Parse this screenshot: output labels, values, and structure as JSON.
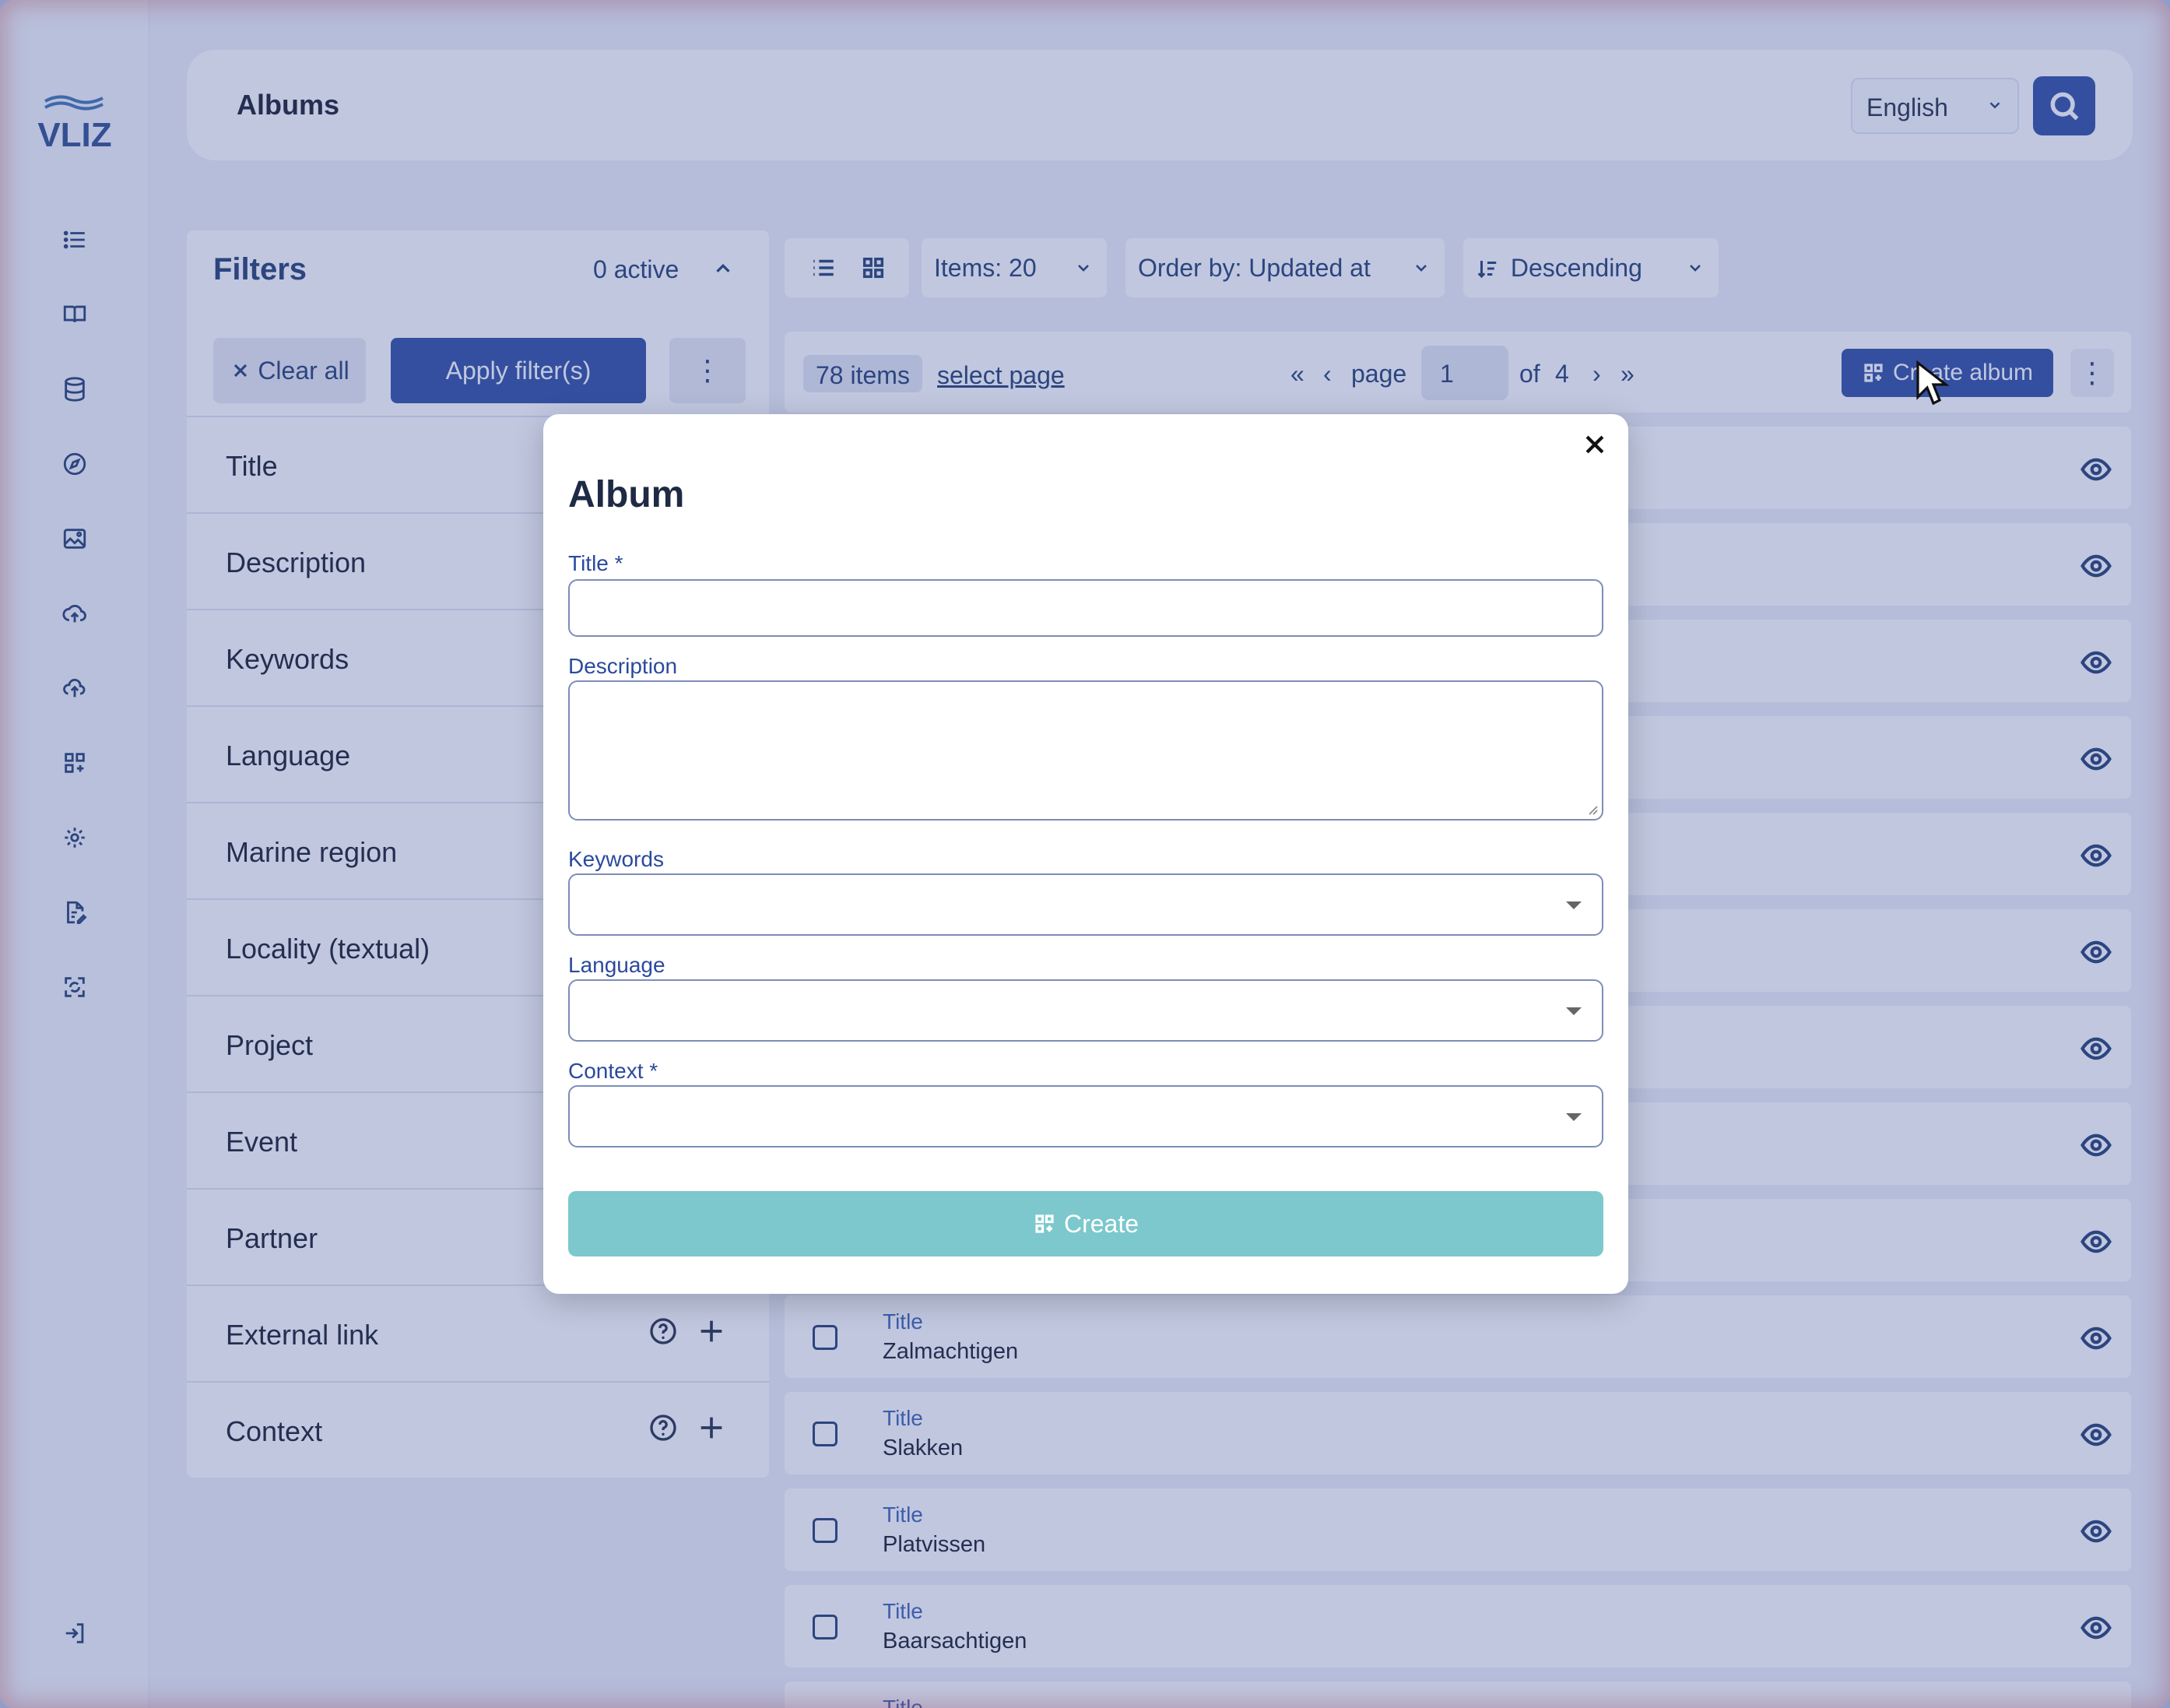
{
  "app": {
    "logo_text": "VLIZ"
  },
  "header": {
    "title": "Albums",
    "language": "English"
  },
  "sidebar": {
    "icons": [
      "list-icon",
      "book-icon",
      "database-icon",
      "compass-icon",
      "image-icon",
      "cloud-upload-icon",
      "upload-icon",
      "grid-plus-icon",
      "settings-icon",
      "document-edit-icon",
      "expand-icon",
      "logout-icon"
    ]
  },
  "filters": {
    "title": "Filters",
    "active": "0 active",
    "clear_all": "Clear all",
    "apply": "Apply filter(s)",
    "rows": [
      "Title",
      "Description",
      "Keywords",
      "Language",
      "Marine region",
      "Locality (textual)",
      "Project",
      "Event",
      "Partner",
      "External link",
      "Context"
    ]
  },
  "toolbar": {
    "items": "Items: 20",
    "order_by": "Order by: Updated at",
    "direction": "Descending"
  },
  "pagination": {
    "count": "78 items",
    "select_page": "select page",
    "first": "«",
    "prev": "‹",
    "page_label": "page",
    "page_value": "1",
    "of_label": "of",
    "total_pages": "4",
    "next": "›",
    "last": "»",
    "create_album": "Create album"
  },
  "list": {
    "field_label": "Title",
    "items": [
      "Zalmachtigen",
      "Slakken",
      "Platvissen",
      "Baarsachtigen"
    ]
  },
  "modal": {
    "title": "Album",
    "title_label": "Title *",
    "description_label": "Description",
    "keywords_label": "Keywords",
    "language_label": "Language",
    "context_label": "Context *",
    "create": "Create"
  },
  "colors": {
    "primary": "#2b4a9e",
    "create_disabled": "#7cc8cc",
    "overlay": "#465aa0"
  }
}
